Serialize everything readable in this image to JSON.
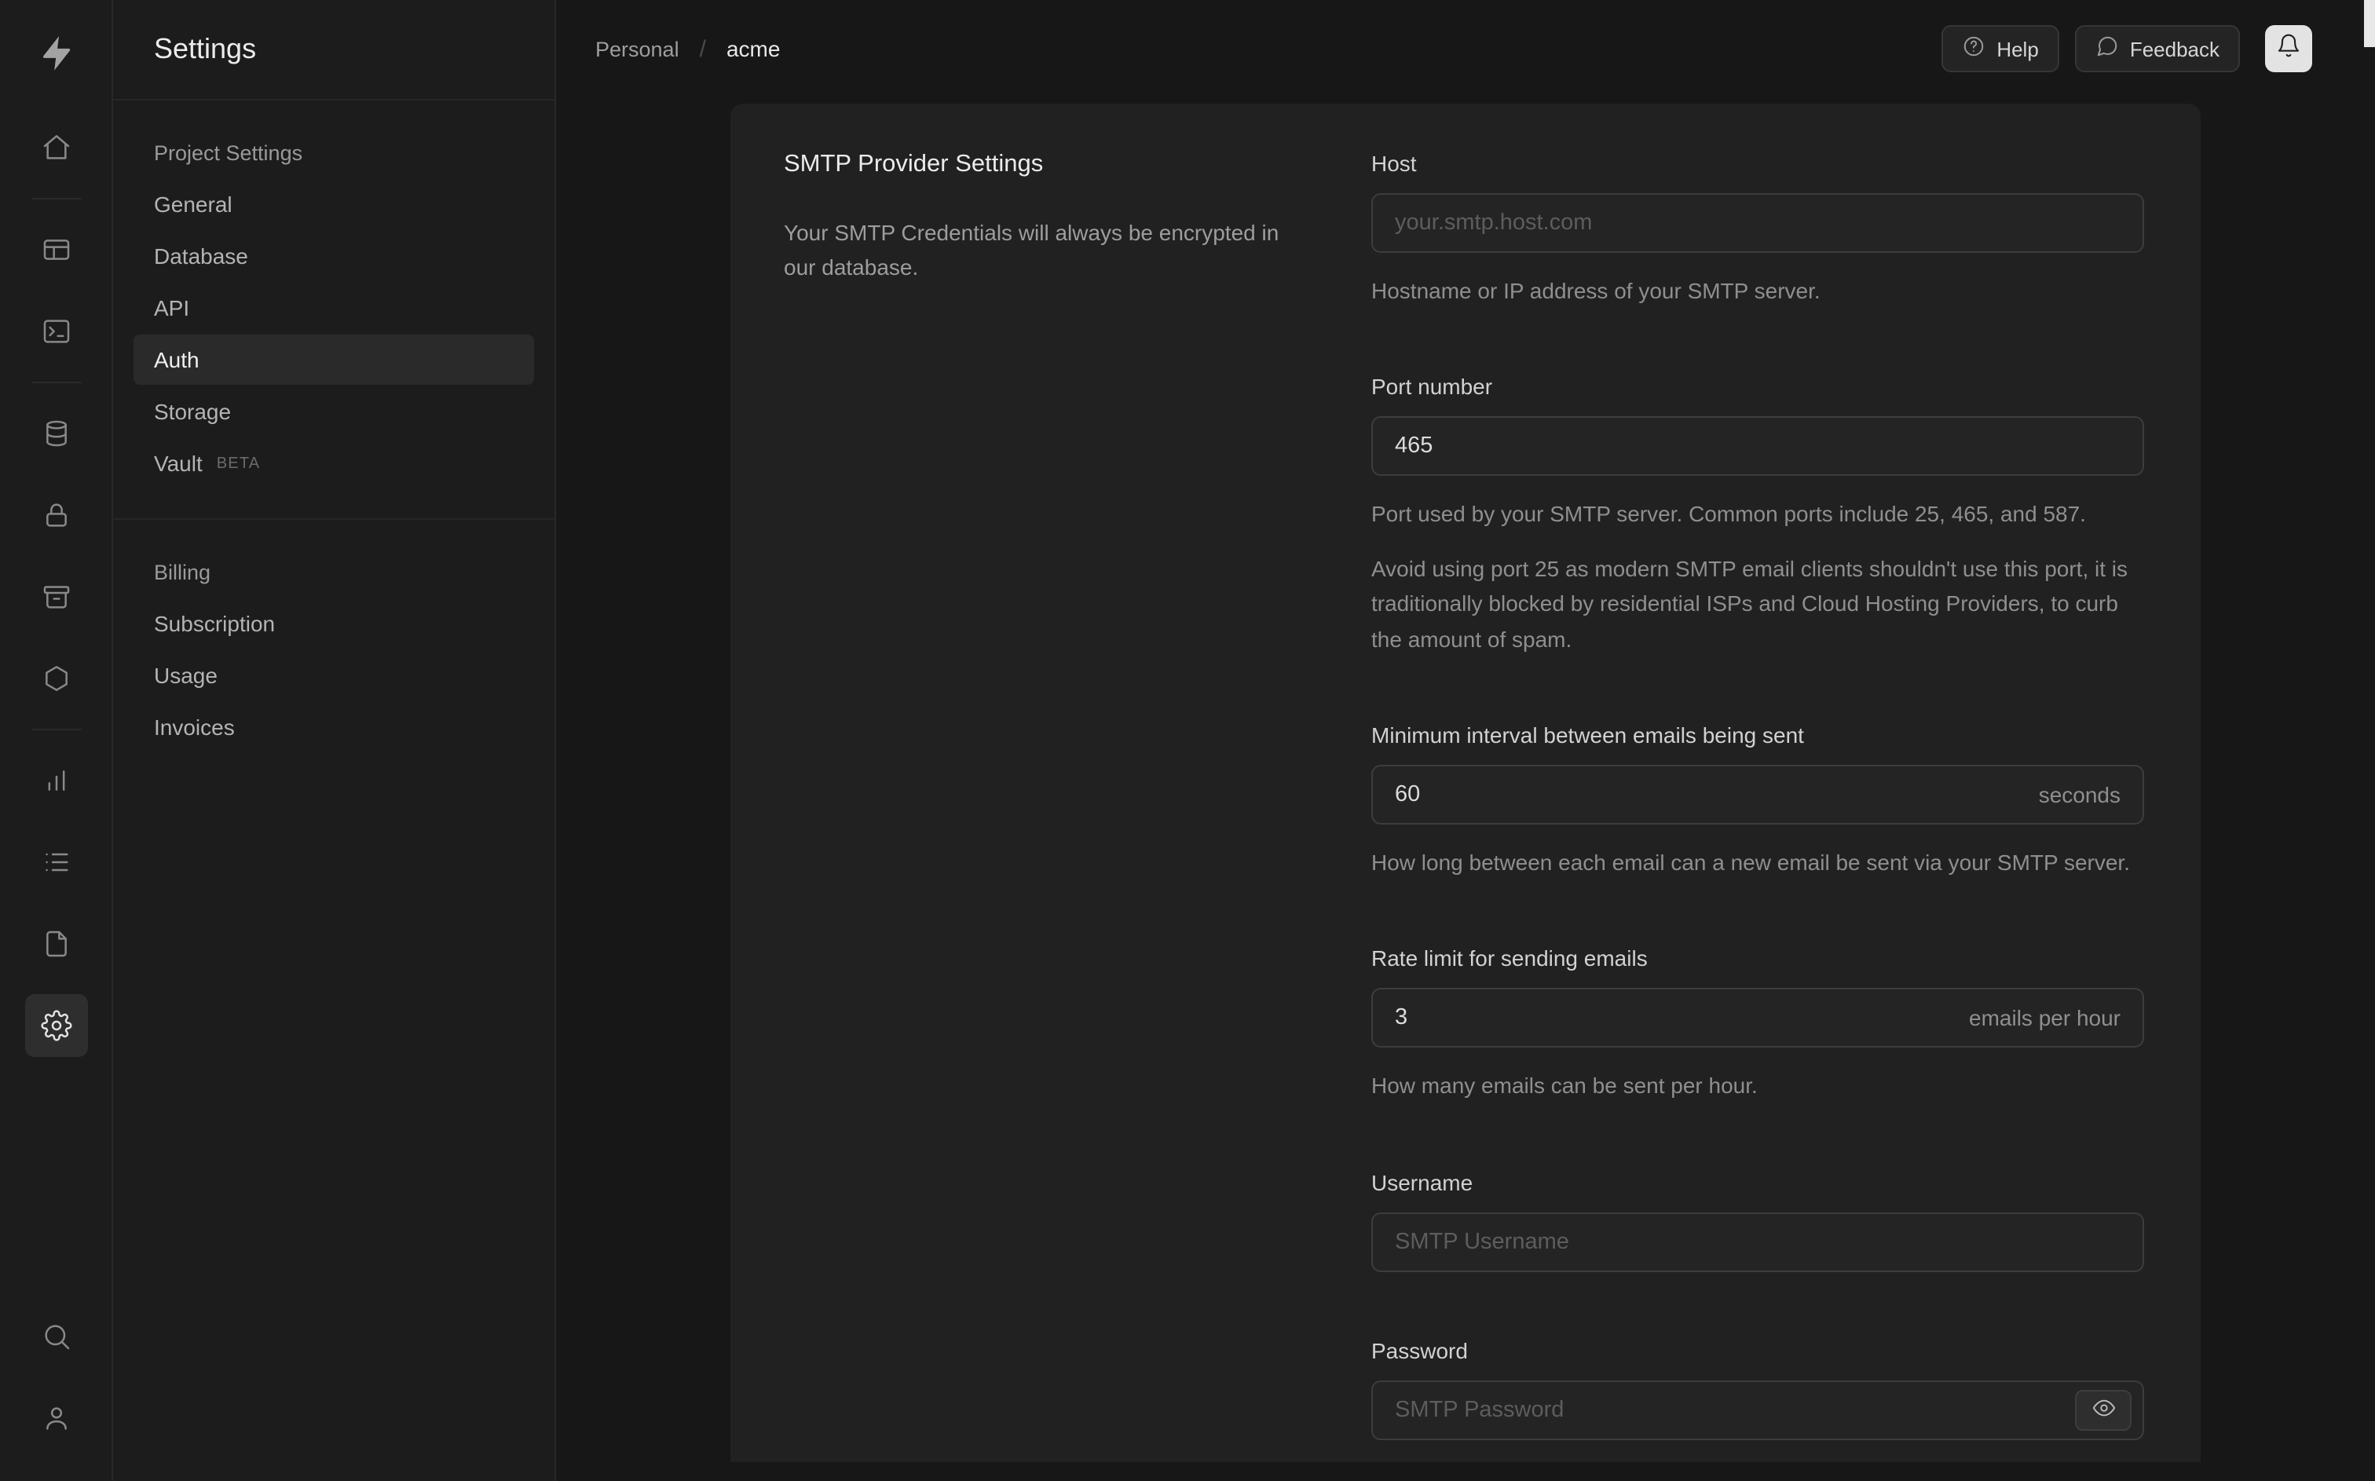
{
  "icon_rail": {
    "items": [
      "home",
      "table-editor",
      "sql-editor",
      "database",
      "authentication",
      "storage",
      "edge-functions",
      "reports",
      "logs",
      "api-docs",
      "project-settings"
    ],
    "bottom_items": [
      "search",
      "user"
    ]
  },
  "sidebar": {
    "title": "Settings",
    "sections": [
      {
        "label": "Project Settings",
        "items": [
          {
            "label": "General"
          },
          {
            "label": "Database"
          },
          {
            "label": "API"
          },
          {
            "label": "Auth"
          },
          {
            "label": "Storage"
          },
          {
            "label": "Vault",
            "badge": "BETA"
          }
        ]
      },
      {
        "label": "Billing",
        "items": [
          {
            "label": "Subscription"
          },
          {
            "label": "Usage"
          },
          {
            "label": "Invoices"
          }
        ]
      }
    ]
  },
  "header": {
    "breadcrumb": {
      "org": "Personal",
      "separator": "/",
      "project": "acme"
    },
    "buttons": {
      "help": "Help",
      "feedback": "Feedback"
    }
  },
  "content": {
    "section": {
      "title": "SMTP Provider Settings",
      "description": "Your SMTP Credentials will always be encrypted in our database."
    },
    "fields": {
      "host": {
        "label": "Host",
        "placeholder": "your.smtp.host.com",
        "help": "Hostname or IP address of your SMTP server."
      },
      "port": {
        "label": "Port number",
        "value": "465",
        "help": "Port used by your SMTP server. Common ports include 25, 465, and 587.",
        "note": "Avoid using port 25 as modern SMTP email clients shouldn't use this port, it is traditionally blocked by residential ISPs and Cloud Hosting Providers, to curb the amount of spam."
      },
      "min_interval": {
        "label": "Minimum interval between emails being sent",
        "value": "60",
        "suffix": "seconds",
        "help": "How long between each email can a new email be sent via your SMTP server."
      },
      "rate_limit": {
        "label": "Rate limit for sending emails",
        "value": "3",
        "suffix": "emails per hour",
        "help": "How many emails can be sent per hour."
      },
      "username": {
        "label": "Username",
        "placeholder": "SMTP Username"
      },
      "password": {
        "label": "Password",
        "placeholder": "SMTP Password"
      }
    }
  },
  "colors": {
    "background": "#171717",
    "surface": "#1c1c1c",
    "card": "#212121",
    "accent": "#3ecf8e"
  }
}
